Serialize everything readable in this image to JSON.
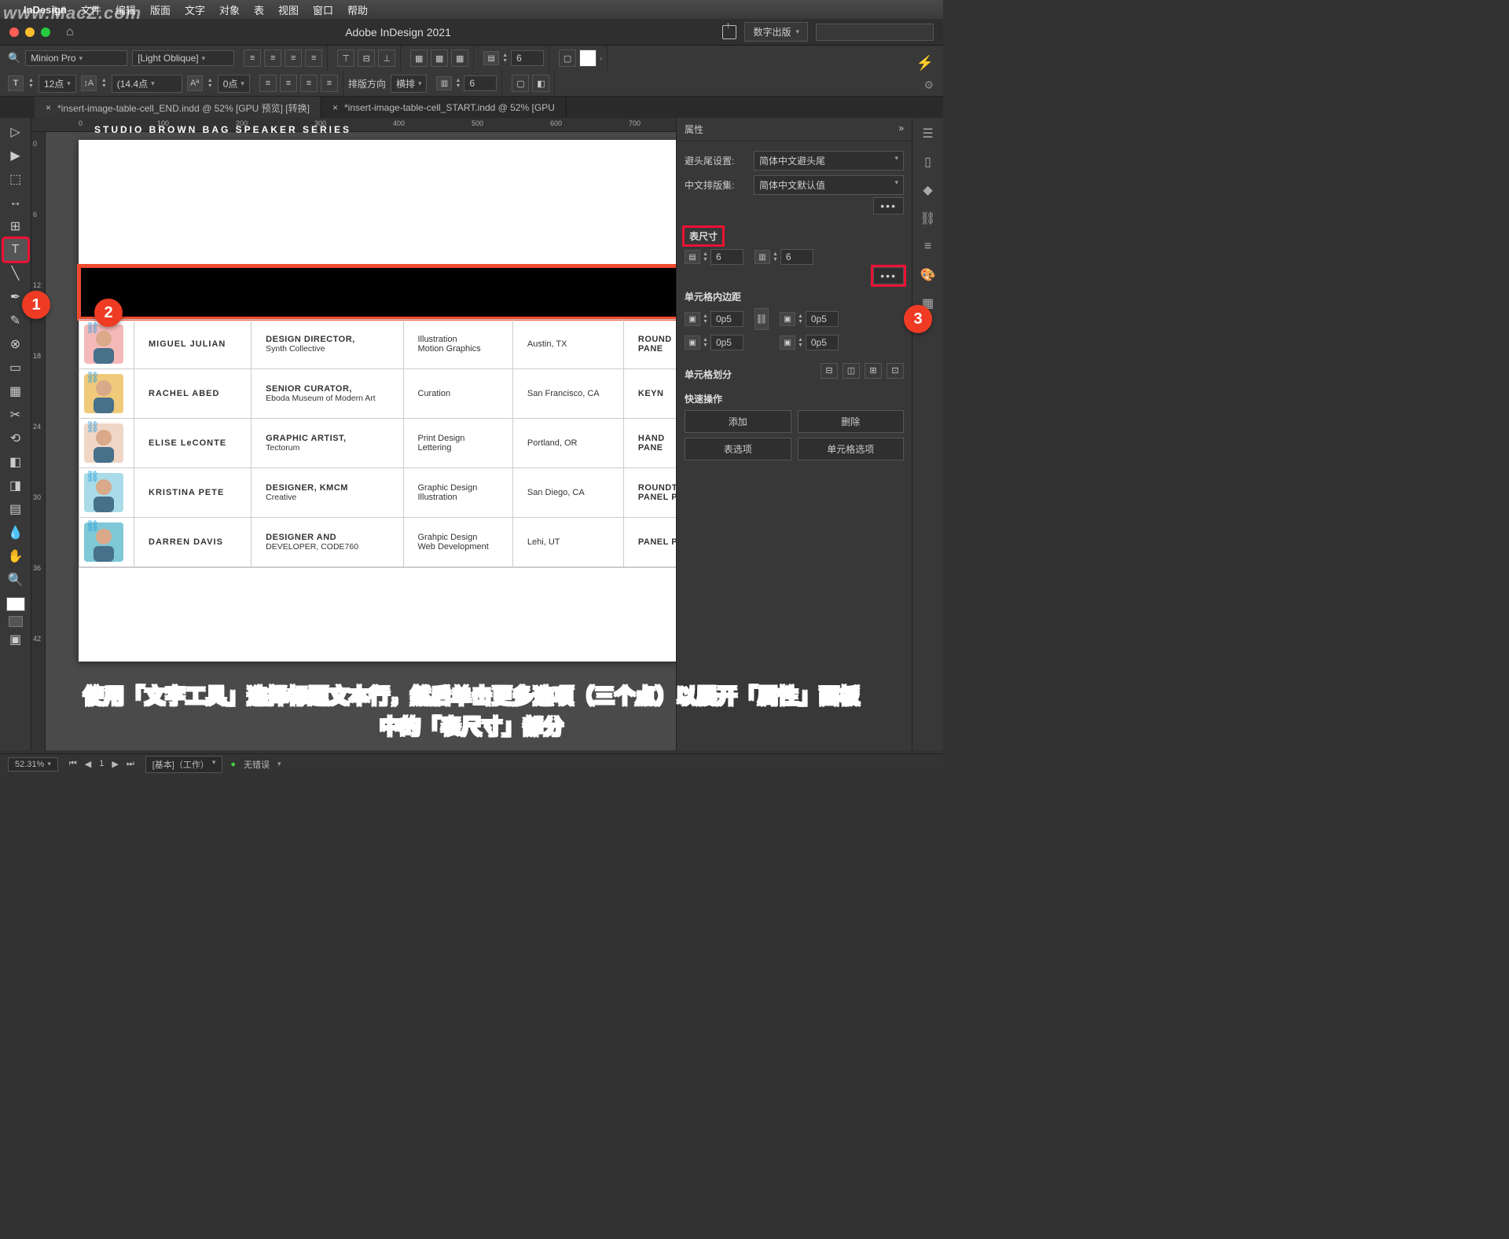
{
  "watermark": "www.MacZ.com",
  "mac_menu": {
    "app": "InDesign",
    "items": [
      "文件",
      "编辑",
      "版面",
      "文字",
      "对象",
      "表",
      "视图",
      "窗口",
      "帮助"
    ]
  },
  "titlebar": {
    "title": "Adobe InDesign 2021",
    "workspace": "数字出版"
  },
  "controlbar": {
    "font_family": "Minion Pro",
    "font_style": "[Light Oblique]",
    "font_size": "12点",
    "leading": "(14.4点",
    "tracking": "0点",
    "layout_dir_label": "排版方向",
    "layout_dir_value": "横排",
    "rows_val": "6",
    "cols_val": "6"
  },
  "tabs": [
    {
      "label": "*insert-image-table-cell_END.indd @ 52% [GPU 预览] [转换]",
      "active": true
    },
    {
      "label": "*insert-image-table-cell_START.indd @ 52% [GPU",
      "active": false
    }
  ],
  "ruler_h": [
    "0",
    "100",
    "200",
    "300",
    "400",
    "500",
    "600",
    "700",
    "800"
  ],
  "ruler_v": [
    "0",
    "6",
    "12",
    "18",
    "24",
    "30",
    "36",
    "42"
  ],
  "page": {
    "header": "STUDIO BROWN BAG SPEAKER SERIES",
    "rows": [
      {
        "avatar_bg": "#f5b9b9",
        "name": "MIGUEL JULIAN",
        "role": "DESIGN DIRECTOR,",
        "org": "Synth Collective",
        "skills1": "Illustration",
        "skills2": "Motion Graphics",
        "loc": "Austin, TX",
        "event": "ROUND\\nPANE"
      },
      {
        "avatar_bg": "#f0c97a",
        "name": "RACHEL ABED",
        "role": "SENIOR CURATOR,",
        "org": "Eboda Museum of Modern Art",
        "skills1": "Curation",
        "skills2": "",
        "loc": "San Francisco, CA",
        "event": "KEYN"
      },
      {
        "avatar_bg": "#efd6c5",
        "name": "ELISE LeCONTE",
        "role": "GRAPHIC ARTIST,",
        "org": "Tectorum",
        "skills1": "Print Design",
        "skills2": "Lettering",
        "loc": "Portland, OR",
        "event": "HAND\\nPANE"
      },
      {
        "avatar_bg": "#a9dce8",
        "name": "KRISTINA PETE",
        "role": "DESIGNER, KMCM",
        "org": "Creative",
        "skills1": "Graphic Design",
        "skills2": "Illustration",
        "loc": "San Diego, CA",
        "event": "ROUNDTABLE\\nPANEL PRESENTATION"
      },
      {
        "avatar_bg": "#7fc8d6",
        "name": "DARREN DAVIS",
        "role": "DESIGNER AND",
        "org": "DEVELOPER, CODE760",
        "skills1": "Grahpic Design",
        "skills2": "Web Development",
        "loc": "Lehi, UT",
        "event": "PANEL PRESENTATION"
      }
    ]
  },
  "props": {
    "title": "属性",
    "avoid_label": "避头尾设置:",
    "avoid_value": "简体中文避头尾",
    "cjk_label": "中文排版集:",
    "cjk_value": "简体中文默认值",
    "table_dim_title": "表尺寸",
    "rows": "6",
    "cols": "6",
    "inset_title": "单元格内边距",
    "inset_t": "0p5",
    "inset_b": "0p5",
    "inset_l": "0p5",
    "inset_r": "0p5",
    "split_title": "单元格划分",
    "quick_title": "快速操作",
    "btn_add": "添加",
    "btn_delete": "删除",
    "btn_table_opts": "表选项",
    "btn_cell_opts": "单元格选项"
  },
  "statusbar": {
    "zoom": "52.31%",
    "master": "[基本]（工作）",
    "errors": "无错误"
  },
  "instruction_line1": "使用「文字工具」选择标题文本行，然后单击更多选项（三个点）以展开「属性」面板",
  "instruction_line2": "中的「表尺寸」部分",
  "callouts": {
    "c1": "1",
    "c2": "2",
    "c3": "3"
  }
}
